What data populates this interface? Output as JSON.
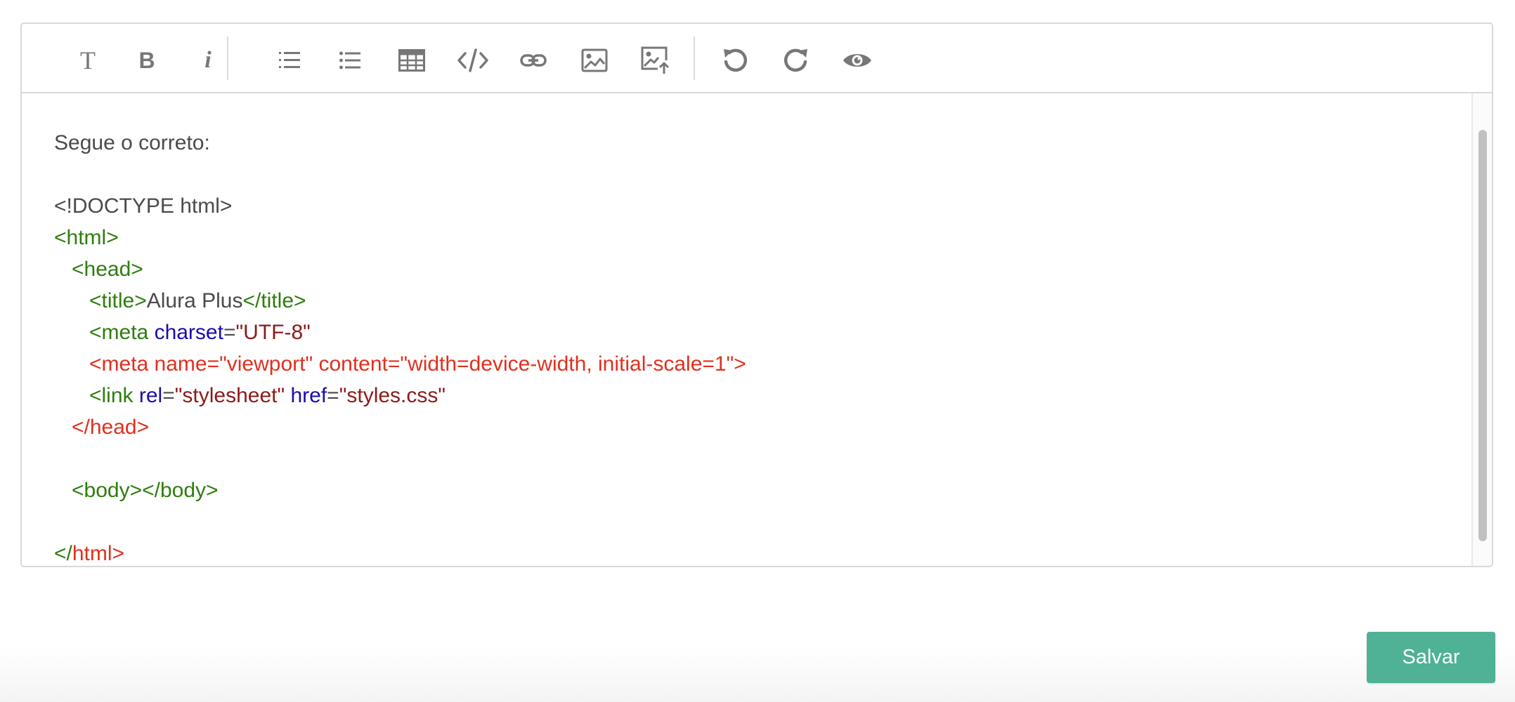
{
  "toolbar": {
    "items": [
      {
        "name": "text-style-icon",
        "glyph": "T"
      },
      {
        "name": "bold-icon",
        "glyph": "B"
      },
      {
        "name": "italic-icon",
        "glyph": "i"
      },
      {
        "name": "ordered-list-icon"
      },
      {
        "name": "unordered-list-icon"
      },
      {
        "name": "table-icon"
      },
      {
        "name": "code-icon"
      },
      {
        "name": "link-icon"
      },
      {
        "name": "image-icon"
      },
      {
        "name": "image-upload-icon"
      },
      {
        "name": "undo-icon"
      },
      {
        "name": "redo-icon"
      },
      {
        "name": "preview-eye-icon"
      }
    ],
    "icon_color": "#777777"
  },
  "editor": {
    "intro": "Segue o correto:",
    "code": {
      "doctype": "<!DOCTYPE html>",
      "html_open": "<html>",
      "head_open": "<head>",
      "title_open": "<title>",
      "title_text": "Alura Plus",
      "title_close": "</title>",
      "meta_open": "<meta ",
      "meta_charset_attr": "charset",
      "eq": "=",
      "meta_charset_val": "\"UTF-8\"",
      "meta_viewport": "<meta name=\"viewport\" content=\"width=device-width, initial-scale=1\">",
      "link_open": "<link ",
      "link_rel_attr": "rel",
      "link_rel_val": "\"stylesheet\"",
      "link_href_attr": "href",
      "link_href_val": "\"styles.css\"",
      "head_close": "</head>",
      "body": "<body></body>",
      "html_close_slash": "</",
      "html_close_name": "html>"
    },
    "colors": {
      "tag": "#2e7d0e",
      "attribute": "#1a0dab",
      "string": "#8b1a1a",
      "error": "#e0301e",
      "text": "#4a4a4a"
    }
  },
  "actions": {
    "save_label": "Salvar",
    "save_color": "#4fb195"
  }
}
